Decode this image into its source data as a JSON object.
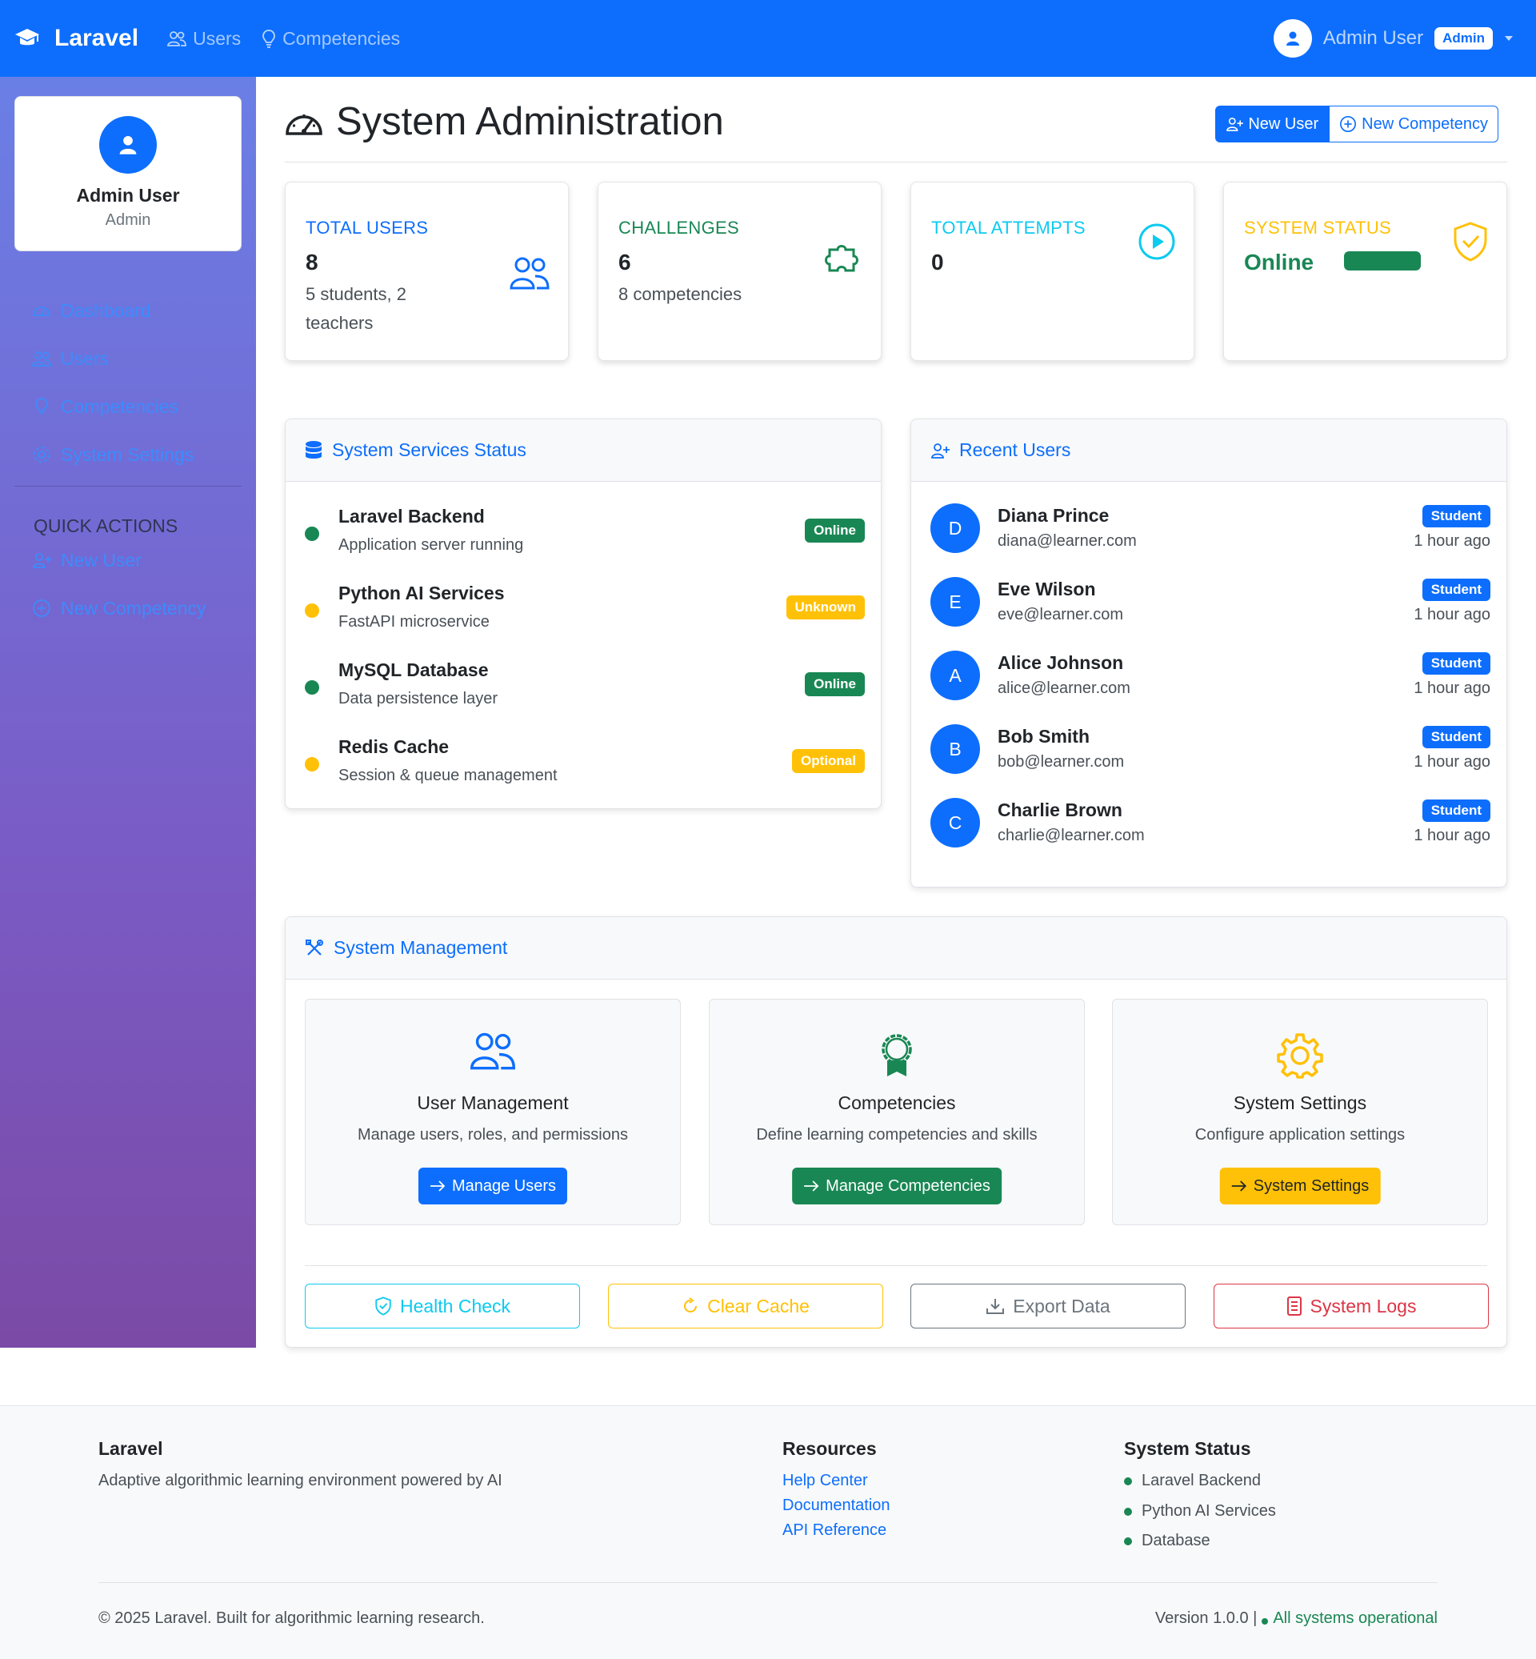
{
  "navbar": {
    "brand": "Laravel",
    "links": [
      "Users",
      "Competencies"
    ],
    "user_name": "Admin User",
    "user_badge": "Admin"
  },
  "sidebar": {
    "profile_name": "Admin User",
    "profile_role": "Admin",
    "items": [
      {
        "label": "Dashboard",
        "icon": "speedometer-icon"
      },
      {
        "label": "Users",
        "icon": "people-icon"
      },
      {
        "label": "Competencies",
        "icon": "lightbulb-icon"
      },
      {
        "label": "System Settings",
        "icon": "gear-icon"
      }
    ],
    "quick_actions_title": "QUICK ACTIONS",
    "quick_actions": [
      {
        "label": "New User",
        "icon": "person-plus-icon"
      },
      {
        "label": "New Competency",
        "icon": "plus-circle-icon"
      }
    ]
  },
  "header": {
    "title": "System Administration",
    "new_user_label": "New User",
    "new_competency_label": "New Competency"
  },
  "stats": [
    {
      "title": "TOTAL USERS",
      "value": "8",
      "sub": "5 students, 2 teachers",
      "color": "#0d6efd",
      "icon": "people-icon"
    },
    {
      "title": "CHALLENGES",
      "value": "6",
      "sub": "8 competencies",
      "color": "#198754",
      "icon": "puzzle-icon"
    },
    {
      "title": "TOTAL ATTEMPTS",
      "value": "0",
      "sub": "",
      "color": "#0dcaf0",
      "icon": "play-circle-icon"
    },
    {
      "title": "SYSTEM STATUS",
      "value": "Online",
      "sub": "",
      "color": "#ffc107",
      "icon": "shield-check-icon",
      "progress": 1.0
    }
  ],
  "services": {
    "title": "System Services Status",
    "items": [
      {
        "name": "Laravel Backend",
        "desc": "Application server running",
        "status": "Online",
        "color": "#198754"
      },
      {
        "name": "Python AI Services",
        "desc": "FastAPI microservice",
        "status": "Unknown",
        "color": "#ffc107"
      },
      {
        "name": "MySQL Database",
        "desc": "Data persistence layer",
        "status": "Online",
        "color": "#198754"
      },
      {
        "name": "Redis Cache",
        "desc": "Session & queue management",
        "status": "Optional",
        "color": "#ffc107"
      }
    ]
  },
  "recent_users": {
    "title": "Recent Users",
    "items": [
      {
        "initial": "D",
        "name": "Diana Prince",
        "email": "diana@learner.com",
        "role": "Student",
        "time": "1 hour ago"
      },
      {
        "initial": "E",
        "name": "Eve Wilson",
        "email": "eve@learner.com",
        "role": "Student",
        "time": "1 hour ago"
      },
      {
        "initial": "A",
        "name": "Alice Johnson",
        "email": "alice@learner.com",
        "role": "Student",
        "time": "1 hour ago"
      },
      {
        "initial": "B",
        "name": "Bob Smith",
        "email": "bob@learner.com",
        "role": "Student",
        "time": "1 hour ago"
      },
      {
        "initial": "C",
        "name": "Charlie Brown",
        "email": "charlie@learner.com",
        "role": "Student",
        "time": "1 hour ago"
      }
    ]
  },
  "management": {
    "title": "System Management",
    "cards": [
      {
        "title": "User Management",
        "desc": "Manage users, roles, and permissions",
        "button": "Manage Users",
        "color": "#0d6efd"
      },
      {
        "title": "Competencies",
        "desc": "Define learning competencies and skills",
        "button": "Manage Competencies",
        "color": "#198754"
      },
      {
        "title": "System Settings",
        "desc": "Configure application settings",
        "button": "System Settings",
        "color": "#ffc107"
      }
    ],
    "actions": [
      {
        "label": "Health Check",
        "color": "#0dcaf0",
        "icon": "shield-check-icon"
      },
      {
        "label": "Clear Cache",
        "color": "#ffc107",
        "icon": "refresh-icon"
      },
      {
        "label": "Export Data",
        "color": "#6c757d",
        "icon": "download-icon"
      },
      {
        "label": "System Logs",
        "color": "#dc3545",
        "icon": "journal-icon"
      }
    ]
  },
  "footer": {
    "brand": "Laravel",
    "tagline": "Adaptive algorithmic learning environment powered by AI",
    "resources_title": "Resources",
    "resources": [
      "Help Center",
      "Documentation",
      "API Reference"
    ],
    "status_title": "System Status",
    "status_items": [
      "Laravel Backend",
      "Python AI Services",
      "Database"
    ],
    "copyright": "© 2025 Laravel. Built for algorithmic learning research.",
    "version": "Version 1.0.0 |",
    "operational": "All systems operational"
  }
}
